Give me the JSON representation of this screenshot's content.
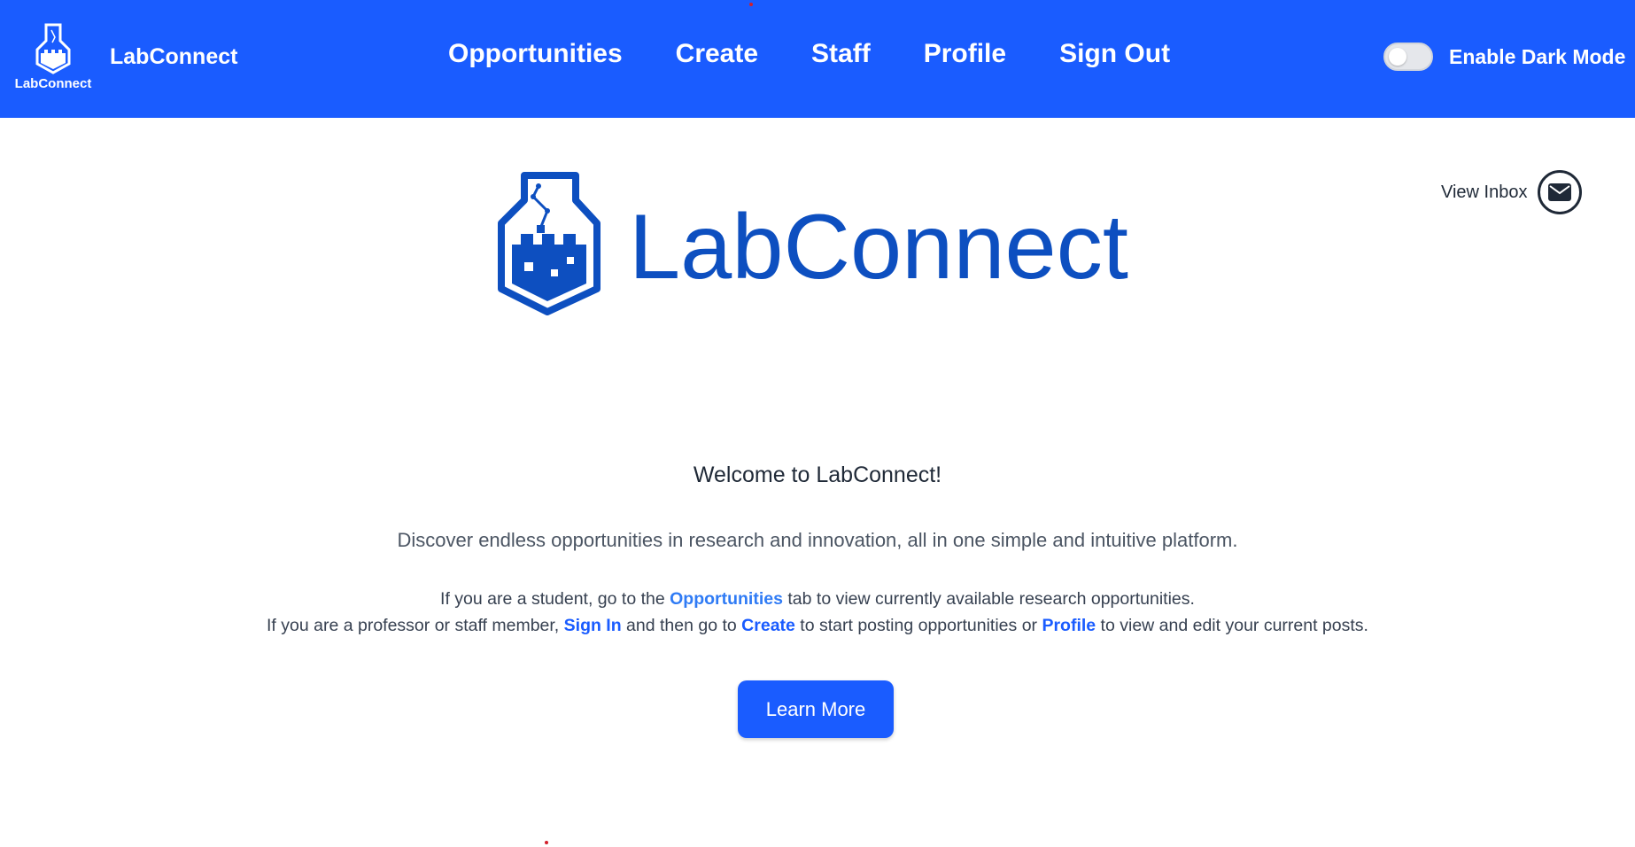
{
  "navbar": {
    "logo_caption": "LabConnect",
    "brand": "LabConnect",
    "links": [
      "Opportunities",
      "Create",
      "Staff",
      "Profile",
      "Sign Out"
    ],
    "dark_mode_label": "Enable Dark Mode",
    "dark_mode_enabled": false,
    "background_color": "#1a5cff"
  },
  "hero": {
    "logo_text": "LabConnect",
    "logo_color": "#0d4fc0"
  },
  "inbox": {
    "label": "View Inbox",
    "icon": "envelope-icon"
  },
  "main": {
    "welcome": "Welcome to LabConnect!",
    "discover": "Discover endless opportunities in research and innovation, all in one simple and intuitive platform.",
    "student_line": {
      "before": "If you are a student, go to the ",
      "link": "Opportunities",
      "after": " tab to view currently available research opportunities."
    },
    "staff_line": {
      "part1": "If you are a professor or staff member, ",
      "link1": "Sign In",
      "part2": " and then go to ",
      "link2": "Create",
      "part3": " to start posting opportunities or ",
      "link3": "Profile",
      "part4": " to view and edit your current posts."
    },
    "learn_more": "Learn More"
  }
}
